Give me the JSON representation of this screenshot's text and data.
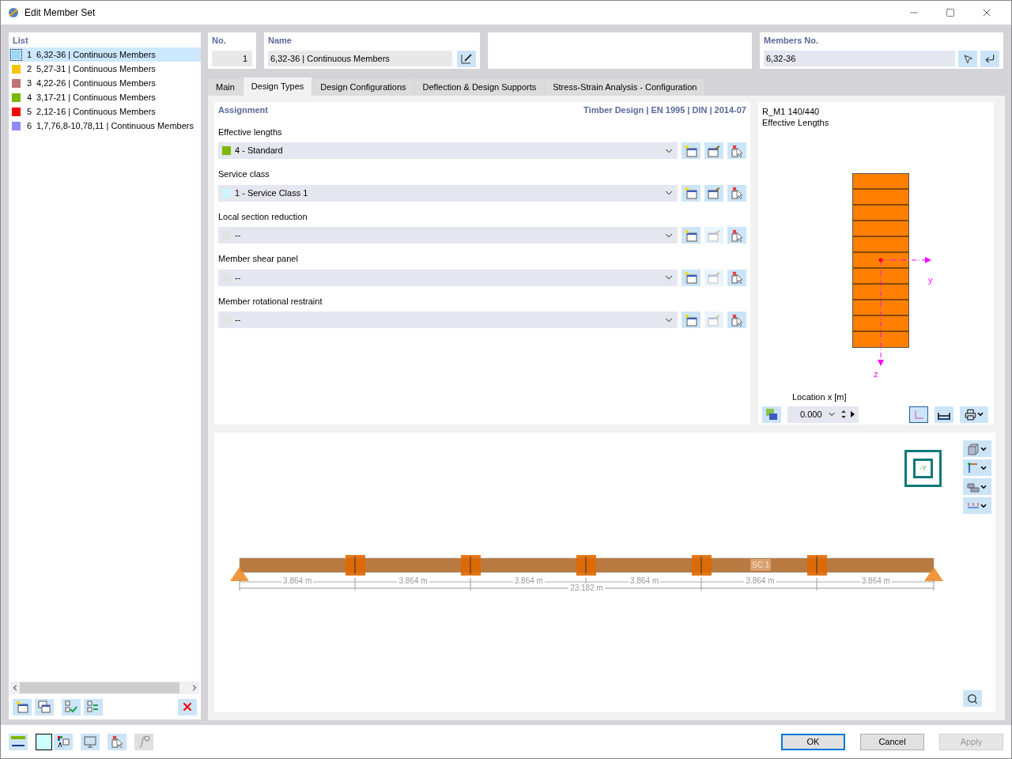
{
  "window": {
    "title": "Edit Member Set"
  },
  "list": {
    "title": "List",
    "items": [
      {
        "number": "1",
        "text": "6,32-36 | Continuous Members",
        "color": "#99d9f5",
        "selected": true
      },
      {
        "number": "2",
        "text": "5,27-31 | Continuous Members",
        "color": "#f5c400",
        "selected": false
      },
      {
        "number": "3",
        "text": "4,22-26 | Continuous Members",
        "color": "#bf7373",
        "selected": false
      },
      {
        "number": "4",
        "text": "3,17-21 | Continuous Members",
        "color": "#7cb800",
        "selected": false
      },
      {
        "number": "5",
        "text": "2,12-16 | Continuous Members",
        "color": "#ff0000",
        "selected": false
      },
      {
        "number": "6",
        "text": "1,7,76,8-10,78,11 | Continuous Members",
        "color": "#8c8cff",
        "selected": false
      }
    ]
  },
  "no": {
    "label": "No.",
    "value": "1"
  },
  "name": {
    "label": "Name",
    "value": "6,32-36 | Continuous Members"
  },
  "members_no": {
    "label": "Members No.",
    "value": "6,32-36"
  },
  "tabs": [
    {
      "label": "Main",
      "selected": false
    },
    {
      "label": "Design Types",
      "selected": true
    },
    {
      "label": "Design Configurations",
      "selected": false
    },
    {
      "label": "Deflection & Design Supports",
      "selected": false
    },
    {
      "label": "Stress-Strain Analysis - Configuration",
      "selected": false
    }
  ],
  "assignment": {
    "title": "Assignment",
    "standard": "Timber Design | EN 1995 | DIN | 2014-07",
    "rows": [
      {
        "label": "Effective lengths",
        "value": "4 - Standard",
        "color": "#7cb800",
        "edit_disabled": false
      },
      {
        "label": "Service class",
        "value": "1 - Service Class 1",
        "color": "#ccf5ff",
        "edit_disabled": false
      },
      {
        "label": "Local section reduction",
        "value": "--",
        "color": "#e2e2e2",
        "edit_disabled": true
      },
      {
        "label": "Member shear panel",
        "value": "--",
        "color": "#e2e2e2",
        "edit_disabled": true
      },
      {
        "label": "Member rotational restraint",
        "value": "--",
        "color": "#e2e2e2",
        "edit_disabled": true
      }
    ]
  },
  "section": {
    "name": "R_M1 140/440",
    "subtitle": "Effective Lengths",
    "y_axis": "y",
    "z_axis": "z",
    "location_label": "Location x [m]",
    "location_value": "0.000"
  },
  "diagram": {
    "spans": [
      "3.864 m",
      "3.864 m",
      "3.864 m",
      "3.864 m",
      "3.864 m",
      "3.864 m"
    ],
    "total": "23.182 m",
    "view_label": "-Y",
    "set_label": "SC 1"
  },
  "buttons": [
    {
      "label": "OK",
      "default": true,
      "disabled": false
    },
    {
      "label": "Cancel",
      "default": false,
      "disabled": false
    },
    {
      "label": "Apply",
      "default": false,
      "disabled": true
    }
  ]
}
